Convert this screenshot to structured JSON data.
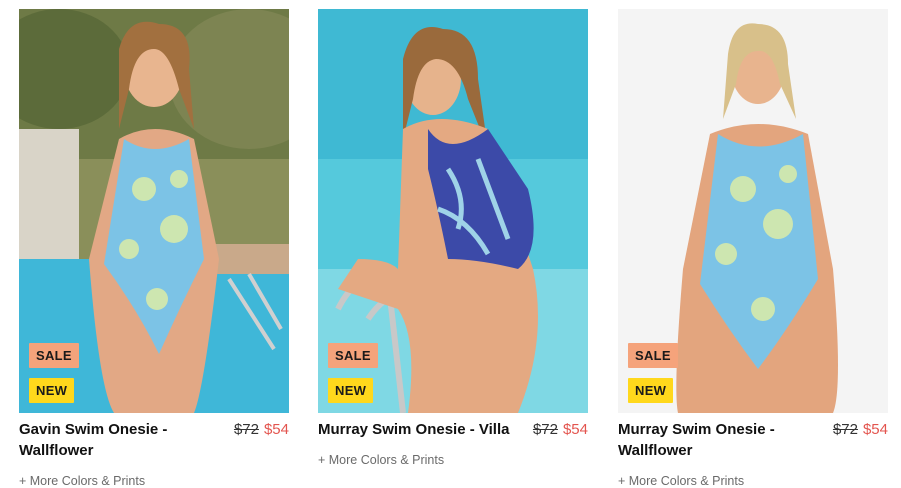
{
  "products": [
    {
      "title": "Gavin Swim Onesie - Wallflower",
      "badges": {
        "sale": "SALE",
        "new": "NEW"
      },
      "price_original": "$72",
      "price_sale": "$54",
      "more_link": "+ More Colors & Prints",
      "colors": {
        "swimsuit": "#7cc3e6",
        "print": "#cde6b0",
        "background": "pool-garden"
      }
    },
    {
      "title": "Murray Swim Onesie - Villa",
      "badges": {
        "sale": "SALE",
        "new": "NEW"
      },
      "price_original": "$72",
      "price_sale": "$54",
      "more_link": "+ More Colors & Prints",
      "colors": {
        "swimsuit": "#3c4aa8",
        "print": "#9fd3e8",
        "background": "pool-water"
      }
    },
    {
      "title": "Murray Swim Onesie - Wallflower",
      "badges": {
        "sale": "SALE",
        "new": "NEW"
      },
      "price_original": "$72",
      "price_sale": "$54",
      "more_link": "+ More Colors & Prints",
      "colors": {
        "swimsuit": "#7cc3e6",
        "print": "#cde6b0",
        "background": "studio-white"
      }
    }
  ],
  "theme": {
    "sale_badge": "#f5a37b",
    "new_badge": "#ffd81c",
    "sale_price": "#e3554f",
    "muted_text": "#6a6a6a"
  }
}
